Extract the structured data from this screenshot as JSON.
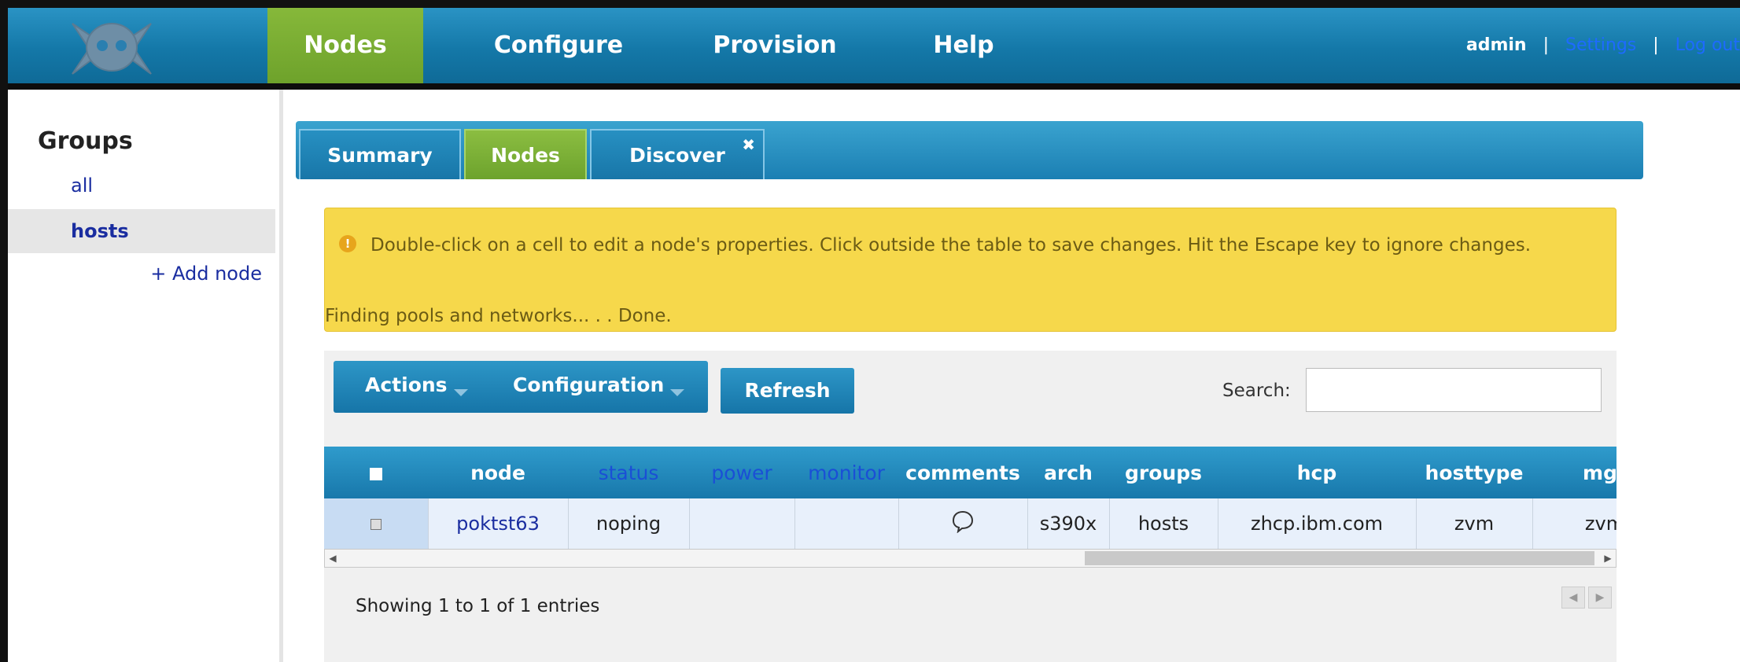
{
  "nav": {
    "logo": "skull-crossbones-logo",
    "items": [
      {
        "label": "Nodes",
        "active": true
      },
      {
        "label": "Configure",
        "active": false
      },
      {
        "label": "Provision",
        "active": false
      },
      {
        "label": "Help",
        "active": false
      }
    ],
    "user": "admin",
    "separator": "|",
    "settings": "Settings",
    "logout": "Log out"
  },
  "sidebar": {
    "title": "Groups",
    "groups": [
      {
        "label": "all",
        "selected": false
      },
      {
        "label": "hosts",
        "selected": true
      }
    ],
    "add_node": "+ Add node"
  },
  "tabs": [
    {
      "label": "Summary",
      "active": false
    },
    {
      "label": "Nodes",
      "active": true
    },
    {
      "label": "Discover",
      "active": false,
      "closable": true
    }
  ],
  "tab_close": "✖",
  "info": {
    "icon": "warning-icon",
    "icon_glyph": "!",
    "message": "Double-click on a cell to edit a node's properties. Click outside the table to save changes. Hit the Escape key to ignore changes.",
    "status": "Finding pools and networks... . . Done."
  },
  "toolbar": {
    "actions": "Actions",
    "configuration": "Configuration",
    "refresh": "Refresh",
    "search_label": "Search:",
    "search_value": ""
  },
  "table": {
    "columns": [
      "node",
      "status",
      "power",
      "monitor",
      "comments",
      "arch",
      "groups",
      "hcp",
      "hosttype",
      "mgt"
    ],
    "link_columns": [
      "status",
      "power",
      "monitor"
    ],
    "rows": [
      {
        "node": "poktst63",
        "status": "noping",
        "power": "",
        "monitor": "",
        "comments": "comment-icon",
        "arch": "s390x",
        "groups": "hosts",
        "hcp": "zhcp.ibm.com",
        "hosttype": "zvm",
        "mgt": "zvm"
      }
    ]
  },
  "footer": {
    "info": "Showing 1 to 1 of 1 entries",
    "prev": "◀",
    "next": "▶"
  },
  "scroll": {
    "left": "◀",
    "right": "▶"
  },
  "colors": {
    "accent_blue": "#1b7fb3",
    "active_green": "#6ea22b",
    "info_yellow": "#f6d84b"
  }
}
